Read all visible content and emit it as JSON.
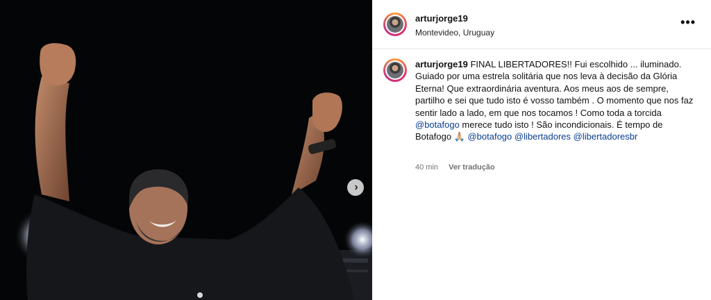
{
  "post": {
    "username": "arturjorge19",
    "location": "Montevideo, Uruguay",
    "more_icon": "more-horizontal-icon",
    "next_icon": "chevron-right-icon"
  },
  "caption": {
    "username": "arturjorge19",
    "text_1": " FINAL LIBERTADORES!! Fui escolhido ... iluminado. Guiado por uma estrela solitária que nos leva à decisão da Glória Eterna! Que extraordinária aventura. Aos meus aos de sempre, partilho e sei que tudo isto é vosso também . O momento que nos faz sentir lado a lado, em que nos tocamos ! Como toda a torcida ",
    "mention_1": "@botafogo",
    "text_2": " merece tudo isto ! São incondicionais. É tempo de Botafogo ",
    "emoji": "🙏🏼",
    "mention_2": "@botafogo",
    "mention_3": "@libertadores",
    "mention_4": "@libertadoresbr"
  },
  "meta": {
    "time": "40 min",
    "translate": "Ver tradução"
  },
  "colors": {
    "link": "#0a3d8f",
    "muted": "#737373",
    "media_bg": "#050608"
  }
}
